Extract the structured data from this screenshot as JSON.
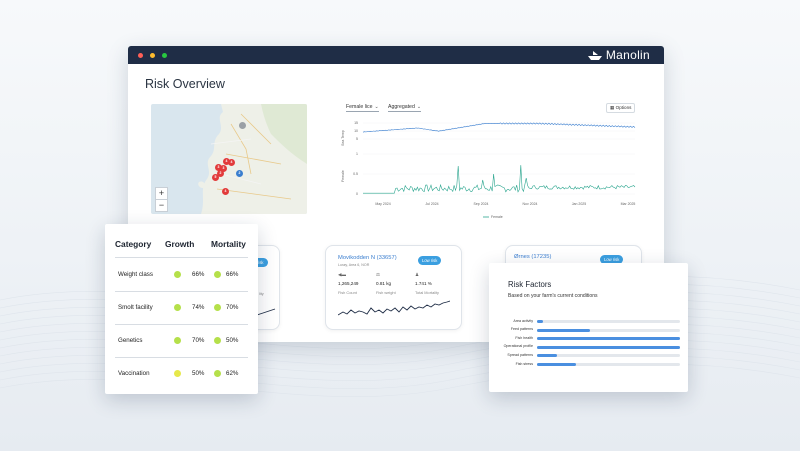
{
  "window": {
    "brand": "Manolin",
    "page_title": "Risk Overview",
    "controls_colors": [
      "#ff5f57",
      "#febc2e",
      "#28c840"
    ]
  },
  "map": {
    "zoom_in": "+",
    "zoom_out": "−",
    "markers": [
      {
        "label": "4",
        "color": "#e23b3b"
      },
      {
        "label": "4",
        "color": "#e23b3b"
      },
      {
        "label": "3",
        "color": "#e23b3b"
      },
      {
        "label": "2",
        "color": "#e23b3b"
      },
      {
        "label": "5",
        "color": "#e23b3b"
      },
      {
        "label": "2",
        "color": "#3a7ecf"
      },
      {
        "label": "4",
        "color": "#e23b3b"
      },
      {
        "label": "3",
        "color": "#e23b3b"
      },
      {
        "label": "",
        "color": "#9aa0a6"
      }
    ]
  },
  "chart_controls": {
    "metric": "Female lice",
    "aggregation": "Aggregated",
    "options": "Options"
  },
  "chart_data": {
    "type": "line",
    "x_ticks": [
      "May 2024",
      "Jul 2024",
      "Sep 2024",
      "Nov 2024",
      "Jan 2025",
      "Mar 2025"
    ],
    "top_panel": {
      "ylabel": "Sea Temp",
      "y_ticks": [
        "15",
        "10",
        "5"
      ],
      "color": "#3a7ecf"
    },
    "bottom_panel": {
      "ylabel": "Female",
      "y_ticks": [
        "1",
        "0.5",
        "0"
      ],
      "color": "#2aa58e"
    },
    "legend": "Female"
  },
  "farm_cards": [
    {
      "name": "Movikodden N (33657)",
      "location": "Lurøy, Area 6, NOR",
      "badge": "Low risk",
      "fish_count": "1,265,249",
      "fish_count_label": "Fish Count",
      "fish_weight": "0.81 kg",
      "fish_weight_label": "Fish weight",
      "mortality": "1.741 %",
      "mortality_label": "Total Mortality"
    },
    {
      "name": "Ørnes (17235)",
      "badge": "Low risk"
    },
    {
      "badge": "risk",
      "mortality_label": "lity"
    }
  ],
  "categories": {
    "headers": {
      "category": "Category",
      "growth": "Growth",
      "mortality": "Mortality"
    },
    "rows": [
      {
        "name": "Weight class",
        "growth": "66%",
        "growth_color": "#b5e04a",
        "mortality": "66%",
        "mortality_color": "#b5e04a"
      },
      {
        "name": "Smolt facility",
        "growth": "74%",
        "growth_color": "#b5e04a",
        "mortality": "70%",
        "mortality_color": "#b5e04a"
      },
      {
        "name": "Genetics",
        "growth": "70%",
        "growth_color": "#b5e04a",
        "mortality": "50%",
        "mortality_color": "#b5e04a"
      },
      {
        "name": "Vaccination",
        "growth": "50%",
        "growth_color": "#e6e84a",
        "mortality": "62%",
        "mortality_color": "#b5e04a"
      }
    ]
  },
  "risk_factors": {
    "title": "Risk Factors",
    "subtitle": "Based on your farm's current conditions",
    "items": [
      {
        "label": "Area activity",
        "value": 0.04
      },
      {
        "label": "Feed patterns",
        "value": 0.37
      },
      {
        "label": "Fish health",
        "value": 1.0
      },
      {
        "label": "Operational profile",
        "value": 1.0
      },
      {
        "label": "Spread patterns",
        "value": 0.14
      },
      {
        "label": "Fish stress",
        "value": 0.27
      }
    ]
  }
}
